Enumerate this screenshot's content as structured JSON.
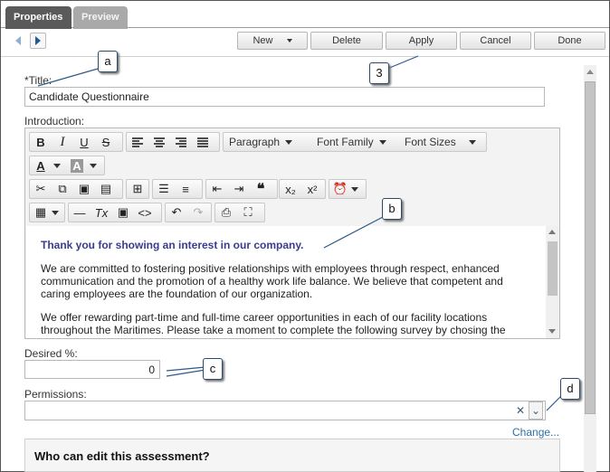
{
  "tabs": [
    {
      "label": "Properties",
      "active": true
    },
    {
      "label": "Preview",
      "active": false
    }
  ],
  "nav": {
    "back_icon": "left-arrow",
    "forward_icon": "right-arrow"
  },
  "toolbar": {
    "new_label": "New",
    "delete_label": "Delete",
    "apply_label": "Apply",
    "cancel_label": "Cancel",
    "done_label": "Done"
  },
  "form": {
    "title_label": "*Title:",
    "title_value": "Candidate Questionnaire",
    "intro_label": "Introduction:",
    "desired_label": "Desired %:",
    "desired_value": "0",
    "permissions_label": "Permissions:",
    "permissions_value": "",
    "change_link": "Change...",
    "box_heading": "Who can edit this assessment?"
  },
  "editor": {
    "paragraph_dd": "Paragraph",
    "font_family_dd": "Font Family",
    "font_sizes_dd": "Font Sizes",
    "heading_text": "Thank you for showing an interest in our company.",
    "para1": "We are committed to fostering positive relationships with employees through respect, enhanced communication and the promotion of a healthy work life balance. We believe that competent and caring employees are the foundation of our organization.",
    "para2": "We offer rewarding part-time and full-time career opportunities in each of our facility locations throughout the Maritimes.  Please take a moment to complete the following survey by chosing the"
  },
  "callouts": {
    "a": "a",
    "b": "b",
    "c": "c",
    "d": "d",
    "three": "3"
  },
  "colors": {
    "heading_blue": "#3b3b8f",
    "link_blue": "#2e6ea6",
    "tab_active": "#5a5a5a",
    "tab_inactive": "#a9a9a9"
  }
}
